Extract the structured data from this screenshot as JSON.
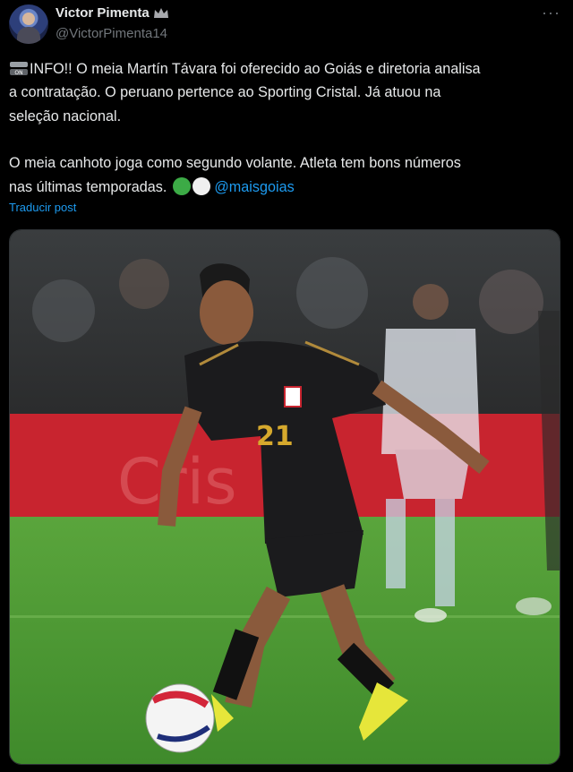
{
  "author": {
    "name": "Victor Pimenta",
    "handle": "@VictorPimenta14",
    "verified_badge_icon": "crown-badge-icon"
  },
  "menu_icon": "more-options-icon",
  "tweet": {
    "lines": [
      "INFO!! O meia Martín Távara foi oferecido ao Goiás e diretoria analisa",
      "a contratação. O peruano pertence ao Sporting Cristal. Já atuou na",
      "seleção nacional."
    ],
    "lines2": [
      "O meia canhoto joga como segundo volante. Atleta tem bons números",
      "nas últimas temporadas."
    ],
    "mention": "@maisgoias",
    "emoji_colors": [
      "#3cab46",
      "#f0f0f0"
    ]
  },
  "translate_link": "Traducir post",
  "media": {
    "jersey_number": "21",
    "board_text": "Cris",
    "colors": {
      "pitch": "#4f9a34",
      "board": "#c8242f",
      "kit": "#1b1b1d",
      "opponent_kit": "#e9eef5"
    }
  }
}
